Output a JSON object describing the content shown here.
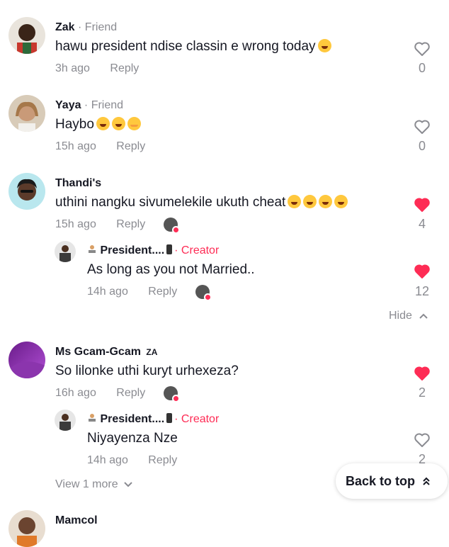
{
  "comments": [
    {
      "name": "Zak",
      "tag": " · Friend",
      "text": "hawu president ndise classin e wrong today",
      "time": "3h ago",
      "reply": "Reply",
      "likes": "0",
      "liked": false
    },
    {
      "name": "Yaya",
      "tag": " · Friend",
      "text": "Haybo",
      "time": "15h ago",
      "reply": "Reply",
      "likes": "0",
      "liked": false
    },
    {
      "name": "Thandi's",
      "text": "uthini nangku sivumelekile ukuth cheat",
      "time": "15h ago",
      "reply": "Reply",
      "likes": "4",
      "liked": true,
      "reply_item": {
        "name": "President....",
        "tag": "· Creator",
        "text": "As long as you not Married..",
        "time": "14h ago",
        "reply": "Reply",
        "likes": "12",
        "liked": true
      }
    },
    {
      "name": "Ms Gcam-Gcam",
      "flag": "ZA",
      "text": "So lilonke uthi kuryt urhexeza?",
      "time": "16h ago",
      "reply": "Reply",
      "likes": "2",
      "liked": true,
      "reply_item": {
        "name": "President....",
        "tag": "· Creator",
        "text": "Niyayenza Nze",
        "time": "14h ago",
        "reply": "Reply",
        "likes": "2",
        "liked": false
      }
    },
    {
      "name": "Mamcol"
    }
  ],
  "hide_label": "Hide",
  "view_more_label": "View 1 more",
  "back_to_top_label": "Back to top",
  "colors": {
    "accent": "#fe2c55",
    "muted": "#8a8b91",
    "text": "#161823"
  }
}
